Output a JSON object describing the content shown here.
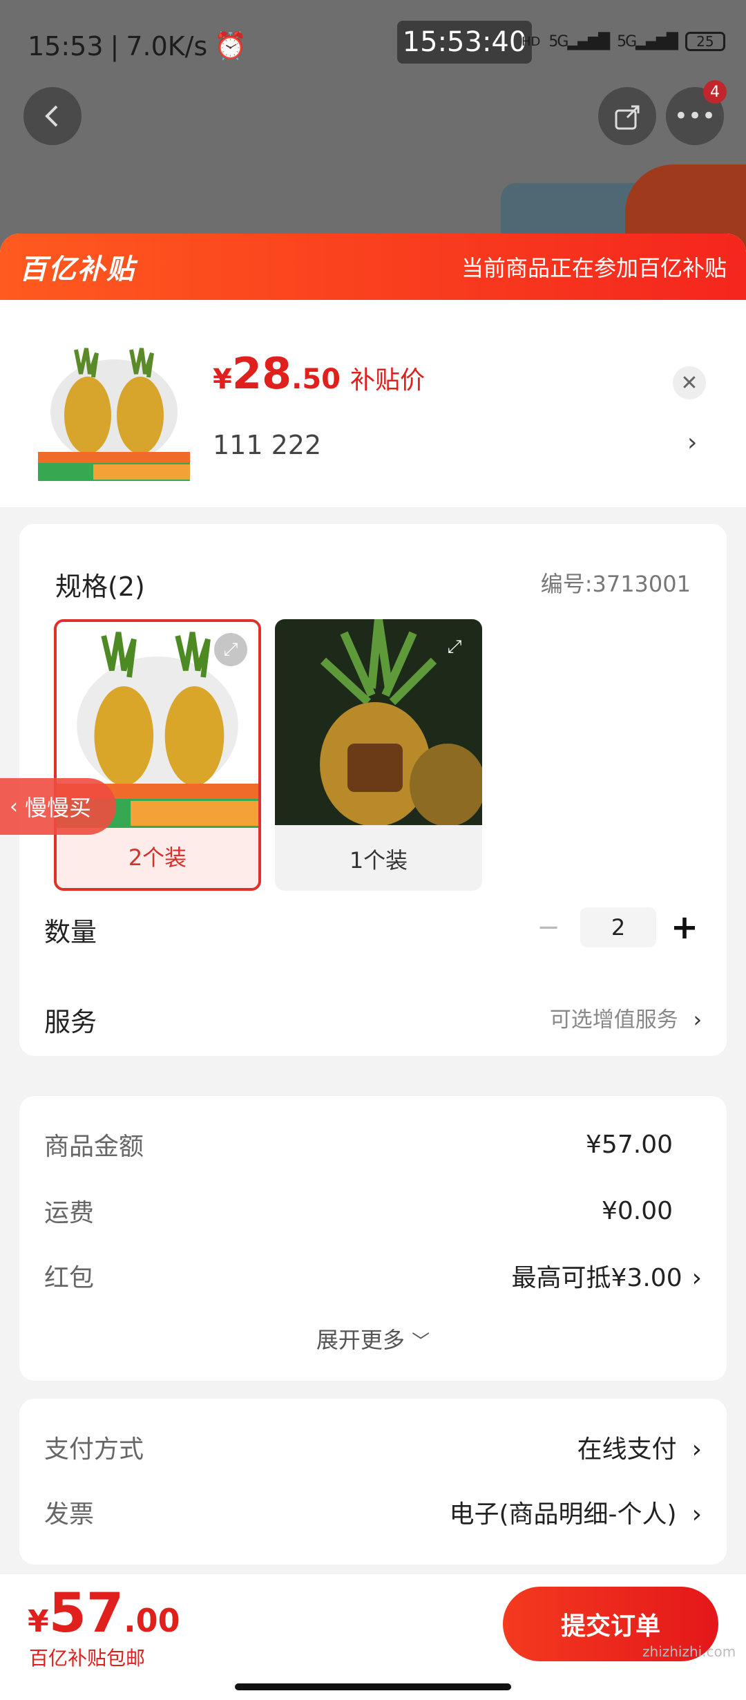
{
  "status_bar": {
    "time": "15:53",
    "speed": "7.0K/s",
    "clock": "15:53:40",
    "battery": "25"
  },
  "sheet": {
    "brand": "百亿补贴",
    "header_note": "当前商品正在参加百亿补贴"
  },
  "product": {
    "currency": "¥",
    "price_int": "28",
    "price_dec": ".50",
    "price_tag": "补贴价",
    "sku_line": "111  222"
  },
  "spec": {
    "title": "规格(2)",
    "code": "编号:3713001",
    "options": [
      {
        "label": "2个装",
        "selected": true
      },
      {
        "label": "1个装",
        "selected": false
      }
    ]
  },
  "quantity": {
    "label": "数量",
    "value": "2",
    "minus": "−",
    "plus": "+"
  },
  "service": {
    "label": "服务",
    "value": "可选增值服务"
  },
  "summary": {
    "goods_label": "商品金额",
    "goods_value": "¥57.00",
    "shipping_label": "运费",
    "shipping_value": "¥0.00",
    "coupon_label": "红包",
    "coupon_value": "最高可抵¥3.00",
    "expand": "展开更多"
  },
  "payment": {
    "method_label": "支付方式",
    "method_value": "在线支付",
    "invoice_label": "发票",
    "invoice_value": "电子(商品明细-个人)"
  },
  "floating_tab": "慢慢买",
  "bottom": {
    "currency": "¥",
    "total_int": "57",
    "total_dec": ".00",
    "note": "百亿补贴包邮",
    "submit": "提交订单",
    "watermark": "zhizhizhi.com"
  },
  "colors": {
    "accent": "#e0201c",
    "header_start": "#ff5a1f",
    "header_end": "#f4261d"
  }
}
